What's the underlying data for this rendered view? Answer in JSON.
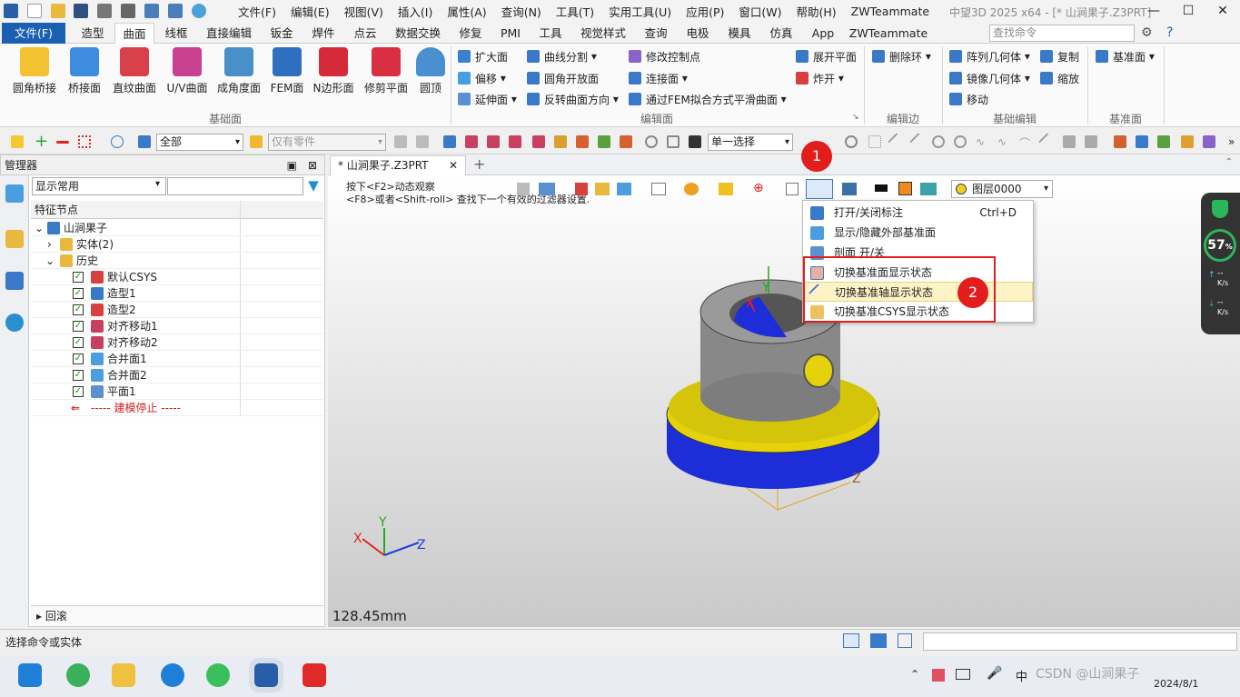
{
  "app": {
    "window_title": "中望3D 2025 x64 - [* 山涧果子.Z3PRT]",
    "menu": [
      "文件(F)",
      "编辑(E)",
      "视图(V)",
      "插入(I)",
      "属性(A)",
      "查询(N)",
      "工具(T)",
      "实用工具(U)",
      "应用(P)",
      "窗口(W)",
      "帮助(H)",
      "ZWTeammate"
    ]
  },
  "ribbon_tabs": [
    "文件(F)",
    "造型",
    "曲面",
    "线框",
    "直接编辑",
    "钣金",
    "焊件",
    "点云",
    "数据交换",
    "修复",
    "PMI",
    "工具",
    "视觉样式",
    "查询",
    "电极",
    "模具",
    "仿真",
    "App",
    "ZWTeammate"
  ],
  "active_tab": "曲面",
  "search_placeholder": "查找命令",
  "ribbon": {
    "big_buttons": [
      "圆角桥接",
      "桥接面",
      "直纹曲面",
      "U/V曲面",
      "成角度面",
      "FEM面",
      "N边形面",
      "修剪平面",
      "圆顶"
    ],
    "group_basic": "基础面",
    "edit_col1": [
      "扩大面",
      "偏移",
      "延伸面"
    ],
    "edit_col2": [
      "曲线分割",
      "圆角开放面",
      "反转曲面方向"
    ],
    "edit_col3": [
      "修改控制点",
      "连接面",
      "通过FEM拟合方式平滑曲面"
    ],
    "edit_col4": [
      "展开平面",
      "炸开"
    ],
    "group_edit": "编辑面",
    "edge_col": [
      "删除环"
    ],
    "group_edge": "编辑边",
    "basic_col1": [
      "阵列几何体",
      "镜像几何体",
      "移动"
    ],
    "basic_col2": [
      "复制",
      "缩放"
    ],
    "group_basicedit": "基础编辑",
    "plane_col": [
      "基准面"
    ],
    "group_plane": "基准面"
  },
  "toolbar": {
    "filter_all": "全部",
    "parts_only": "仅有零件",
    "selection_mode": "单一选择"
  },
  "manager": {
    "title": "管理器",
    "filter": "显示常用",
    "tree_header": "特征节点",
    "root": "山涧果子",
    "solid": "实体(2)",
    "history": "历史",
    "items": [
      "默认CSYS",
      "造型1",
      "造型2",
      "对齐移动1",
      "对齐移动2",
      "合并面1",
      "合并面2",
      "平面1"
    ],
    "stop": "----- 建模停止 -----",
    "rollback": "回滚"
  },
  "document_tab": "* 山涧果子.Z3PRT",
  "viewport": {
    "hint1": "按下<F2>动态观察",
    "hint2": "<F8>或者<Shift-roll> 查找下一个有效的过滤器设置.",
    "layer": "图层0000",
    "measure": "128.45mm",
    "axis_x": "X",
    "axis_y": "Y",
    "axis_z": "Z"
  },
  "popup_menu": [
    {
      "label": "打开/关闭标注",
      "shortcut": "Ctrl+D"
    },
    {
      "label": "显示/隐藏外部基准面",
      "shortcut": ""
    },
    {
      "label": "剖面 开/关",
      "shortcut": ""
    },
    {
      "label": "切换基准面显示状态",
      "shortcut": ""
    },
    {
      "label": "切换基准轴显示状态",
      "shortcut": ""
    },
    {
      "label": "切换基准CSYS显示状态",
      "shortcut": ""
    }
  ],
  "badges": {
    "step1": "1",
    "step2": "2"
  },
  "speed": {
    "percent": "57",
    "pct_sign": "%",
    "up": "--",
    "down": "--",
    "unit": "K/s"
  },
  "status_text": "选择命令或实体",
  "taskbar": {
    "date": "2024/8/1",
    "watermark": "CSDN @山涧果子"
  },
  "colors": {
    "accent": "#1b5fb3",
    "highlight_box": "#e02020",
    "badge": "#e31c1c",
    "model_yellow": "#e5d20a",
    "model_blue": "#1f2fd9",
    "model_gray": "#8c8c8c"
  }
}
